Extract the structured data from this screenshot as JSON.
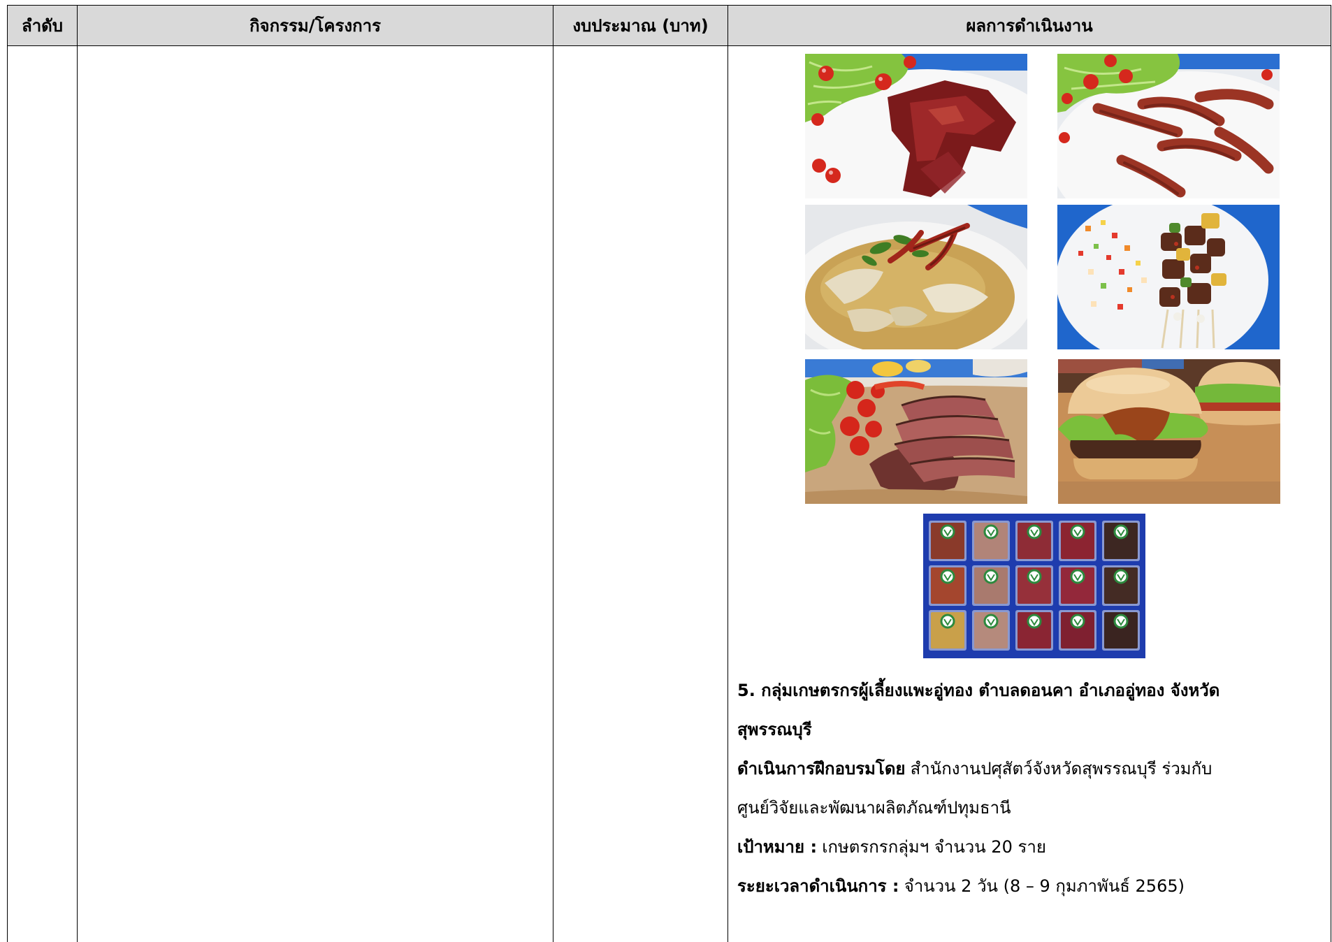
{
  "table": {
    "headers": [
      "ลำดับ",
      "กิจกรรม/โครงการ",
      "งบประมาณ (บาท)",
      "ผลการดำเนินงาน"
    ],
    "row": {
      "results": {
        "group_title_line_1": "5. กลุ่มเกษตรกรผู้เลี้ยงแพะอู่ทอง ตำบลดอนคา อำเภออู่ทอง จังหวัด",
        "group_title_line_2": "สุพรรณบุรี",
        "trainer_label": "ดำเนินการฝึกอบรมโดย",
        "trainer_line_1": "สำนักงานปศุสัตว์จังหวัดสุพรรณบุรี ร่วมกับ",
        "trainer_line_2": "ศูนย์วิจัยและพัฒนาผลิตภัณฑ์ปทุมธานี",
        "target_label": "เป้าหมาย :",
        "target_value": "เกษตรกรกลุ่มฯ จำนวน 20 ราย",
        "duration_label": "ระยะเวลาดำเนินการ :",
        "duration_value": "จำนวน 2 วัน (8 – 9 กุมภาพันธ์ 2565)"
      }
    }
  },
  "colors": {
    "header_bg": "#d9d9d9",
    "border": "#000000",
    "text": "#000000",
    "page_bg": "#ffffff"
  }
}
